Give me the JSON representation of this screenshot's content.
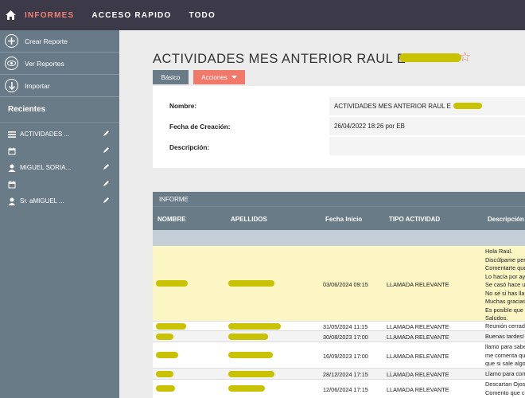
{
  "topnav": {
    "items": [
      "INFORMES",
      "ACCESO RAPIDO",
      "TODO"
    ]
  },
  "sidebar": {
    "actions": [
      "Crear Reporte",
      "Ver Reportes",
      "Importar"
    ],
    "recent_title": "Recientes",
    "recent": [
      "ACTIVIDADES ...",
      "",
      "MIGUEL SORIA...",
      "",
      "Sr. aMIGUEL ..."
    ]
  },
  "main": {
    "title": "ACTIVIDADES MES ANTERIOR RAUL E",
    "tabs": {
      "basic": "Básico",
      "actions": "Acciones"
    },
    "fields": {
      "nombre_label": "Nombre:",
      "nombre_value": "ACTIVIDADES MES ANTERIOR RAUL E",
      "fecha_label": "Fecha de Creación:",
      "fecha_value": "26/04/2022 18:26 por EB",
      "desc_label": "Descripción:",
      "desc_value": ""
    },
    "report": {
      "heading": "INFORME",
      "columns": [
        "NOMBRE",
        "APELLIDOS",
        "Fecha Inicio",
        "TIPO ACTIVIDAD",
        "Descripción"
      ],
      "rows": [
        {
          "fecha": "03/06/2024 09:15",
          "tipo": "LLAMADA RELEVANTE",
          "desc": [
            "Hola Raul.",
            "Discúlpame per",
            "Comentarte que",
            "Lo hacía por ayu",
            "Se casó hace un",
            "No sé si has lla",
            "Muchas gracias",
            "Es posible que s",
            "Saludos."
          ]
        },
        {
          "fecha": "31/05/2024 11:15",
          "tipo": "LLAMADA RELEVANTE",
          "desc": [
            "Reunión cerrad"
          ]
        },
        {
          "fecha": "30/08/2023 17:00",
          "tipo": "LLAMADA RELEVANTE",
          "desc": [
            "Buenas tardes!"
          ]
        },
        {
          "fecha": "16/09/2023 17:00",
          "tipo": "LLAMADA RELEVANTE",
          "desc": [
            "llamo para sabe",
            "me comenta qu",
            "que si sale algo"
          ]
        },
        {
          "fecha": "28/12/2024 17:15",
          "tipo": "LLAMADA RELEVANTE",
          "desc": [
            "Llamo para com"
          ]
        },
        {
          "fecha": "12/06/2024 17:15",
          "tipo": "LLAMADA RELEVANTE",
          "desc": [
            "Descartan Ojos",
            "Comento que cu"
          ]
        }
      ]
    }
  },
  "colors": {
    "accent": "#f08173",
    "nav": "#3c3a49",
    "sidebar": "#6a7b88",
    "highlight": "#fbf6c4"
  }
}
